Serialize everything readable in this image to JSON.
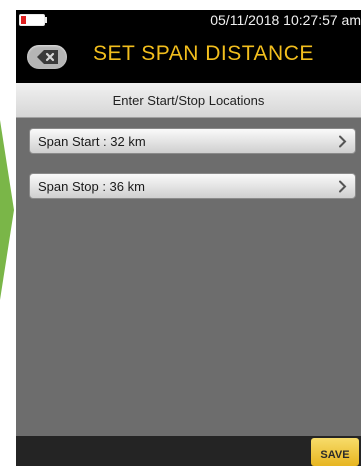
{
  "status_bar": {
    "datetime": "05/11/2018 10:27:57 am",
    "battery_color": "#e02020"
  },
  "header": {
    "title": "SET SPAN DISTANCE",
    "title_color": "#f2be1d",
    "back_icon": "close-x-icon"
  },
  "subheader": {
    "text": "Enter Start/Stop Locations"
  },
  "menu": {
    "items": [
      {
        "label": "Span Start : 32 km",
        "icon": "chevron-right-icon"
      },
      {
        "label": "Span Stop : 36 km",
        "icon": "chevron-right-icon"
      }
    ]
  },
  "footer": {
    "save_label": "SAVE",
    "save_color": "#f2c83a"
  }
}
